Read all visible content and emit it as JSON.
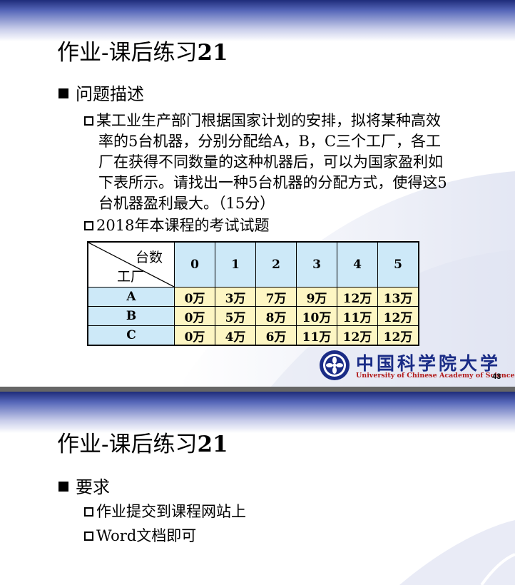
{
  "slide1": {
    "title_prefix": "作业-课后练习",
    "title_num": "21",
    "section": "问题描述",
    "problem_lines": [
      "某工业生产部门根据国家计划的安排，拟将某种高效",
      "率的5台机器，分别分配给A，B，C三个工厂，各工",
      "厂在获得不同数量的这种机器后，可以为国家盈利如",
      "下表所示。请找出一种5台机器的分配方式，使得这5",
      "台机器盈利最大。（15分）"
    ],
    "exam_note": "2018年本课程的考试试题",
    "table": {
      "corner_top": "台数",
      "corner_bottom": "工厂",
      "columns": [
        "0",
        "1",
        "2",
        "3",
        "4",
        "5"
      ],
      "rows": [
        {
          "factory": "A",
          "values": [
            "0万",
            "3万",
            "7万",
            "9万",
            "12万",
            "13万"
          ]
        },
        {
          "factory": "B",
          "values": [
            "0万",
            "5万",
            "8万",
            "10万",
            "11万",
            "12万"
          ]
        },
        {
          "factory": "C",
          "values": [
            "0万",
            "4万",
            "6万",
            "11万",
            "12万",
            "12万"
          ]
        }
      ]
    },
    "logo_cn": "中国科学院大学",
    "logo_en": "University of Chinese Academy of Sciences",
    "page_number": "43"
  },
  "slide2": {
    "title_prefix": "作业-课后练习",
    "title_num": "21",
    "section": "要求",
    "items": [
      "作业提交到课程网站上",
      "Word文档即可"
    ]
  }
}
